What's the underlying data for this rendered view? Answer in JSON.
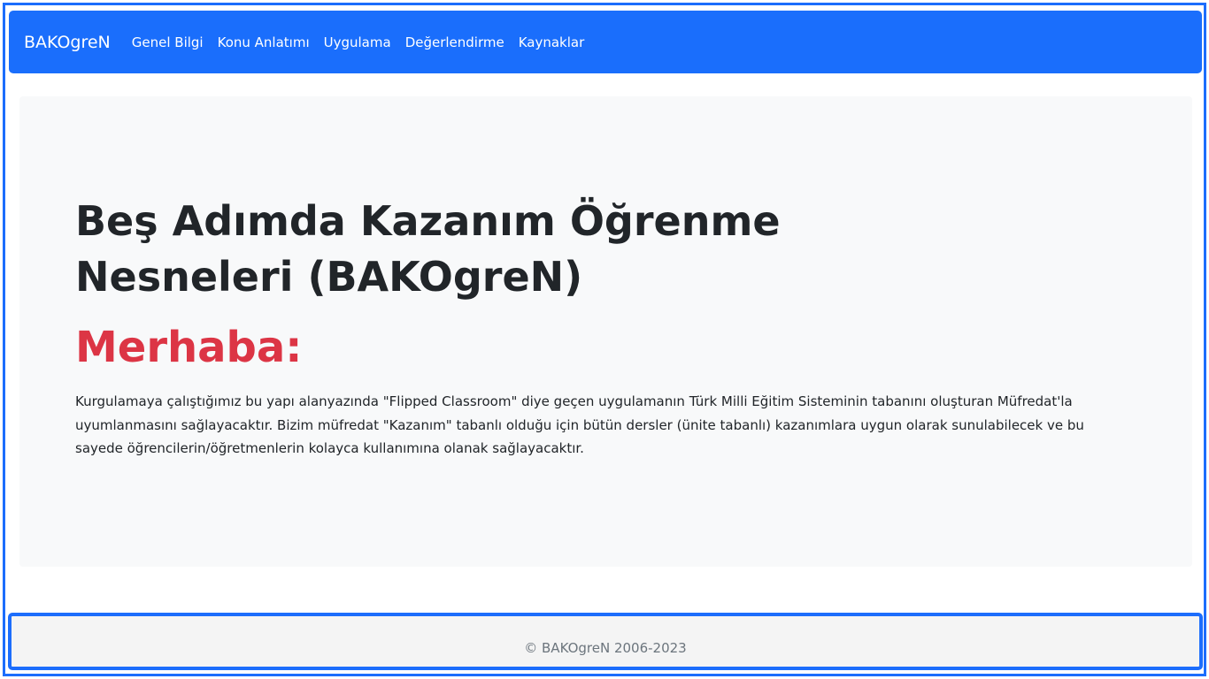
{
  "navbar": {
    "brand": "BAKOgreN",
    "links": [
      {
        "label": "Genel Bilgi"
      },
      {
        "label": "Konu Anlatımı"
      },
      {
        "label": "Uygulama"
      },
      {
        "label": "Değerlendirme"
      },
      {
        "label": "Kaynaklar"
      }
    ]
  },
  "hero": {
    "title": "Beş Adımda Kazanım Öğrenme Nesneleri (BAKOgreN)",
    "greeting": "Merhaba:",
    "paragraph": "Kurgulamaya çalıştığımız bu yapı alanyazında \"Flipped Classroom\" diye geçen uygulamanın Türk Milli Eğitim Sisteminin tabanını oluşturan Müfredat'la uyumlanmasını sağlayacaktır. Bizim müfredat \"Kazanım\" tabanlı olduğu için bütün dersler (ünite tabanlı) kazanımlara uygun olarak sunulabilecek ve bu sayede öğrencilerin/öğretmenlerin kolayca kullanımına olanak sağlayacaktır."
  },
  "footer": {
    "copyright": "© BAKOgreN 2006-2023"
  },
  "colors": {
    "primary": "#1a6efc",
    "danger": "#dc3545",
    "hero_bg": "#f8f9fa",
    "text": "#212529",
    "muted": "#6c757d"
  }
}
